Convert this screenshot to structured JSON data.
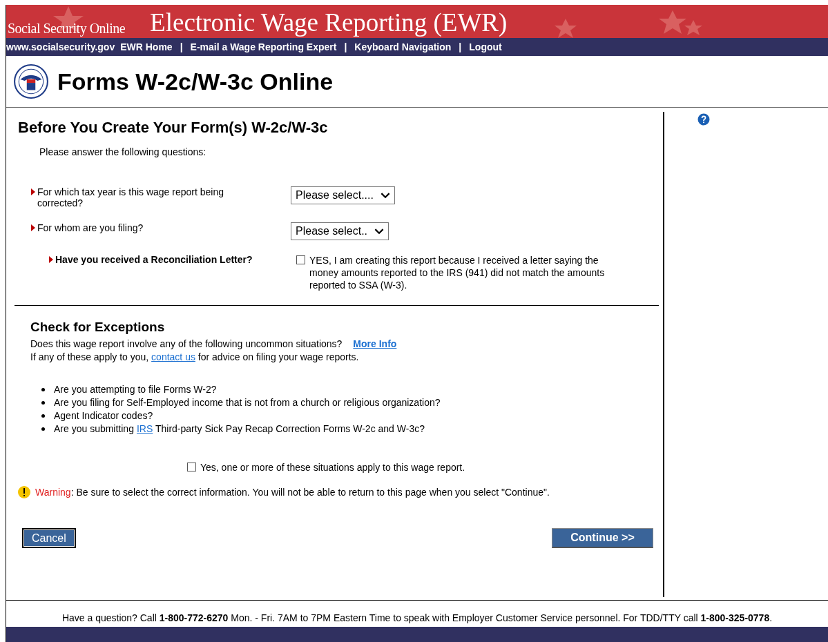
{
  "header": {
    "site": "Social Security Online",
    "title": "Electronic Wage Reporting (EWR)"
  },
  "nav": {
    "home": "www.socialsecurity.gov",
    "links": [
      "EWR Home",
      "E-mail a Wage Reporting Expert",
      "Keyboard Navigation",
      "Logout"
    ],
    "separator": "|"
  },
  "app_title": "Forms W-2c/W-3c Online",
  "page_heading": "Before You Create Your Form(s) W-2c/W-3c",
  "intro": "Please answer the following questions:",
  "questions": [
    {
      "kind": "select",
      "label": "For which tax year is this wage report being corrected?",
      "value": "Please select...."
    },
    {
      "kind": "select",
      "label": "For whom are you filing?",
      "value": "Please select.."
    },
    {
      "kind": "checkbox",
      "label": "Have you received a Reconciliation Letter?",
      "checked": false,
      "option": "YES, I am creating this report because I received a letter saying the money amounts reported to the IRS (941) did not match the amounts reported to SSA (W-3)."
    }
  ],
  "exceptions": {
    "heading": "Check for Exceptions",
    "question": "Does this wage report involve any of the following uncommon situations?",
    "more_info": "More Info",
    "contact": {
      "before": "If any of these apply to you,",
      "link": "contact us",
      "after": "for advice on filing your wage reports."
    },
    "bullets": [
      {
        "before": "Are you attempting to file Forms W-2?"
      },
      {
        "before": "Are you filing for Self-Employed income that is not from a church or religious organization?"
      },
      {
        "before": "Agent Indicator codes?"
      },
      {
        "before": "Are you submitting",
        "link": "IRS",
        "after": "Third-party Sick Pay Recap Correction Forms W-2c and W-3c?"
      }
    ],
    "confirm": {
      "label": "Yes, one or more of these situations apply to this wage report.",
      "checked": false
    }
  },
  "warning": {
    "label": "Warning",
    "text": ": Be sure to select the correct information. You will not be able to return to this page when you select \"Continue\"."
  },
  "buttons": {
    "cancel": "Cancel",
    "continue": "Continue >>"
  },
  "footer": "Have a question? Call **1-800-772-6270** Mon. - Fri. 7AM to 7PM Eastern Time to speak with Employer Customer Service personnel. For TDD/TTY call **1-800-325-0778**."
}
